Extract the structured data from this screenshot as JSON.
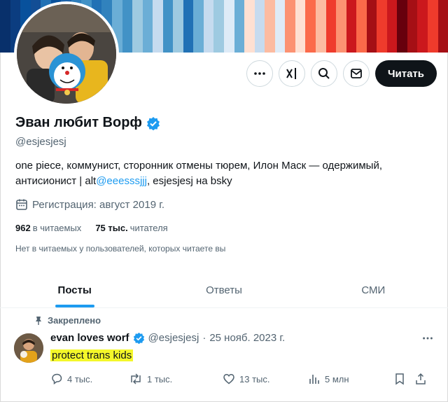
{
  "banner": {
    "stripe_colors": [
      "#08306b",
      "#0b3d80",
      "#08519c",
      "#134e95",
      "#2171b5",
      "#08519c",
      "#1b63ab",
      "#2e7ebc",
      "#4292c6",
      "#2171b5",
      "#3182bd",
      "#6baed6",
      "#4292c6",
      "#9ecae1",
      "#6baed6",
      "#c6dbef",
      "#4292c6",
      "#9ecae1",
      "#2171b5",
      "#6baed6",
      "#c6dbef",
      "#9ecae1",
      "#deebf7",
      "#6baed6",
      "#fee0d2",
      "#c6dbef",
      "#fcbba1",
      "#deebf7",
      "#fc9272",
      "#fee0d2",
      "#fb6a4a",
      "#fcbba1",
      "#ef3b2c",
      "#fc9272",
      "#cb181d",
      "#fb6a4a",
      "#a50f15",
      "#ef3b2c",
      "#cb181d",
      "#67000d",
      "#a50f15",
      "#cb181d",
      "#ef3b2c",
      "#a50f15"
    ]
  },
  "profile": {
    "display_name": "Эван любит Ворф",
    "verified": true,
    "handle": "@esjesjesj",
    "bio_part1": "one piece, коммунист, сторонник отмены тюрем, Илон Маск — одержимый, антисионист | alt",
    "bio_link": "@eeesssjjj",
    "bio_part2": ", esjesjesj на bsky",
    "joined_text": "Регистрация: август 2019 г.",
    "following_count": "962",
    "following_label": "в читаемых",
    "followers_count": "75 тыс.",
    "followers_label": "читателя",
    "followers_note": "Нет в читаемых у пользователей, которых читаете вы"
  },
  "actions": {
    "more_icon": "more-icon",
    "grok_icon": "grok-icon",
    "search_icon": "search-icon",
    "message_icon": "mail-icon",
    "follow_label": "Читать"
  },
  "tabs": [
    {
      "label": "Посты",
      "active": true
    },
    {
      "label": "Ответы",
      "active": false
    },
    {
      "label": "СМИ",
      "active": false
    }
  ],
  "pinned_tweet": {
    "pinned_label": "Закреплено",
    "author_name": "evan loves worf",
    "handle": "@esjesjesj",
    "separator": "·",
    "date": "25 нояб. 2023 г.",
    "text": "protect trans kids",
    "highlight_color": "#f4f72a",
    "replies": "4 тыс.",
    "reposts": "1 тыс.",
    "likes": "13 тыс.",
    "views": "5 млн"
  },
  "colors": {
    "accent": "#1d9bf0",
    "text": "#0f1419",
    "muted": "#536471"
  }
}
